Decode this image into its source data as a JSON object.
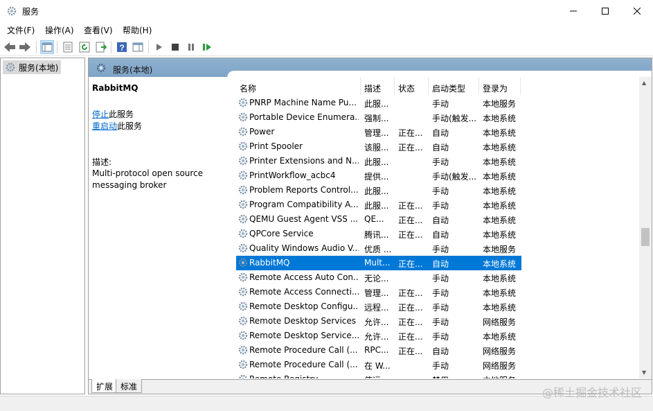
{
  "window": {
    "title": "服务"
  },
  "menu": [
    {
      "label": "文件(F)"
    },
    {
      "label": "操作(A)"
    },
    {
      "label": "查看(V)"
    },
    {
      "label": "帮助(H)"
    }
  ],
  "tree": {
    "item": "服务(本地)"
  },
  "pane": {
    "title": "服务(本地)"
  },
  "detail": {
    "service_name": "RabbitMQ",
    "stop_link": "停止",
    "stop_suffix": "此服务",
    "restart_link": "重启动",
    "restart_suffix": "此服务",
    "desc_label": "描述:",
    "desc_line1": "Multi-protocol open source",
    "desc_line2": "messaging broker"
  },
  "columns": {
    "name": "名称",
    "desc": "描述",
    "status": "状态",
    "startup": "启动类型",
    "logon": "登录为"
  },
  "rows": [
    {
      "name": "PNRP Machine Name Pu...",
      "desc": "此服...",
      "status": "",
      "startup": "手动",
      "logon": "本地服务"
    },
    {
      "name": "Portable Device Enumera...",
      "desc": "强制...",
      "status": "",
      "startup": "手动(触发...",
      "logon": "本地系统"
    },
    {
      "name": "Power",
      "desc": "管理...",
      "status": "正在...",
      "startup": "自动",
      "logon": "本地系统"
    },
    {
      "name": "Print Spooler",
      "desc": "该服...",
      "status": "正在...",
      "startup": "自动",
      "logon": "本地系统"
    },
    {
      "name": "Printer Extensions and N...",
      "desc": "此服...",
      "status": "",
      "startup": "手动",
      "logon": "本地系统"
    },
    {
      "name": "PrintWorkflow_acbc4",
      "desc": "提供...",
      "status": "",
      "startup": "手动(触发...",
      "logon": "本地系统"
    },
    {
      "name": "Problem Reports Control...",
      "desc": "此服...",
      "status": "",
      "startup": "手动",
      "logon": "本地系统"
    },
    {
      "name": "Program Compatibility A...",
      "desc": "此服...",
      "status": "正在...",
      "startup": "手动",
      "logon": "本地系统"
    },
    {
      "name": "QEMU Guest Agent VSS ...",
      "desc": "QE...",
      "status": "正在...",
      "startup": "自动",
      "logon": "本地系统"
    },
    {
      "name": "QPCore Service",
      "desc": "腾讯...",
      "status": "正在...",
      "startup": "自动",
      "logon": "本地系统"
    },
    {
      "name": "Quality Windows Audio V...",
      "desc": "优质 ...",
      "status": "",
      "startup": "手动",
      "logon": "本地服务"
    },
    {
      "name": "RabbitMQ",
      "desc": "Mult...",
      "status": "正在...",
      "startup": "自动",
      "logon": "本地系统"
    },
    {
      "name": "Remote Access Auto Con...",
      "desc": "无论...",
      "status": "",
      "startup": "手动",
      "logon": "本地系统"
    },
    {
      "name": "Remote Access Connecti...",
      "desc": "管理...",
      "status": "正在...",
      "startup": "手动",
      "logon": "本地系统"
    },
    {
      "name": "Remote Desktop Configu...",
      "desc": "远程...",
      "status": "正在...",
      "startup": "手动",
      "logon": "本地系统"
    },
    {
      "name": "Remote Desktop Services",
      "desc": "允许...",
      "status": "正在...",
      "startup": "手动",
      "logon": "网络服务"
    },
    {
      "name": "Remote Desktop Service...",
      "desc": "允许...",
      "status": "正在...",
      "startup": "手动",
      "logon": "本地系统"
    },
    {
      "name": "Remote Procedure Call (...",
      "desc": "RPC...",
      "status": "正在...",
      "startup": "自动",
      "logon": "网络服务"
    },
    {
      "name": "Remote Procedure Call (...",
      "desc": "在 W...",
      "status": "",
      "startup": "手动",
      "logon": "网络服务"
    },
    {
      "name": "Remote Registry",
      "desc": "使远...",
      "status": "",
      "startup": "禁用",
      "logon": "本地服务"
    }
  ],
  "selected_row": "RabbitMQ",
  "tabs": {
    "extended": "扩展",
    "standard": "标准"
  },
  "watermark": "@稀土掘金技术社区",
  "colors": {
    "selection": "#0078d7",
    "header": "#8fb1cf",
    "link": "#0066cc"
  }
}
